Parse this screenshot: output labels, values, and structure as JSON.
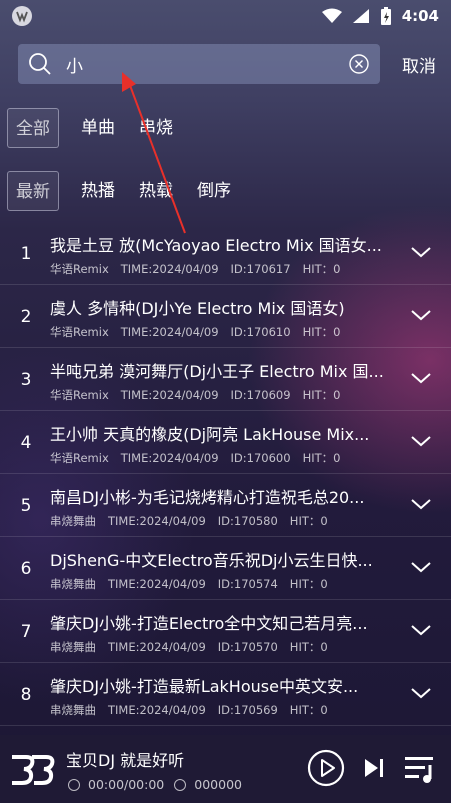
{
  "status_bar": {
    "time": "4:04"
  },
  "search": {
    "value": "小",
    "cancel_label": "取消"
  },
  "category_filters": [
    {
      "label": "全部",
      "active": true
    },
    {
      "label": "单曲",
      "active": false
    },
    {
      "label": "串烧",
      "active": false
    }
  ],
  "sort_filters": [
    {
      "label": "最新",
      "active": true
    },
    {
      "label": "热播",
      "active": false
    },
    {
      "label": "热载",
      "active": false
    },
    {
      "label": "倒序",
      "active": false
    }
  ],
  "songs": [
    {
      "index": "1",
      "title": "我是土豆 放(McYaoyao Electro Mix 国语女...",
      "genre": "华语Remix",
      "time": "TIME:2024/04/09",
      "id": "ID:170617",
      "hit": "HIT：0"
    },
    {
      "index": "2",
      "title": "虞人 多情种(DJ小Ye Electro Mix 国语女)",
      "genre": "华语Remix",
      "time": "TIME:2024/04/09",
      "id": "ID:170610",
      "hit": "HIT：0"
    },
    {
      "index": "3",
      "title": "半吨兄弟 漠河舞厅(Dj小王子 Electro Mix 国...",
      "genre": "华语Remix",
      "time": "TIME:2024/04/09",
      "id": "ID:170609",
      "hit": "HIT：0"
    },
    {
      "index": "4",
      "title": "王小帅 天真的橡皮(Dj阿亮 LakHouse Mix...",
      "genre": "华语Remix",
      "time": "TIME:2024/04/09",
      "id": "ID:170600",
      "hit": "HIT：0"
    },
    {
      "index": "5",
      "title": "南昌DJ小彬-为毛记烧烤精心打造祝毛总20...",
      "genre": "串烧舞曲",
      "time": "TIME:2024/04/09",
      "id": "ID:170580",
      "hit": "HIT：0"
    },
    {
      "index": "6",
      "title": "DjShenG-中文Electro音乐祝Dj小云生日快...",
      "genre": "串烧舞曲",
      "time": "TIME:2024/04/09",
      "id": "ID:170574",
      "hit": "HIT：0"
    },
    {
      "index": "7",
      "title": "肇庆DJ小姚-打造Electro全中文知己若月亮...",
      "genre": "串烧舞曲",
      "time": "TIME:2024/04/09",
      "id": "ID:170570",
      "hit": "HIT：0"
    },
    {
      "index": "8",
      "title": "肇庆DJ小姚-打造最新LakHouse中英文安...",
      "genre": "串烧舞曲",
      "time": "TIME:2024/04/09",
      "id": "ID:170569",
      "hit": "HIT：0"
    }
  ],
  "player": {
    "title": "宝贝DJ 就是好听",
    "time": "00:00/00:00",
    "count": "000000"
  },
  "icons": {
    "search": "search-icon",
    "clear": "clear-icon",
    "expand": "chevron-down-icon",
    "play": "play-icon",
    "next": "next-icon",
    "queue": "playlist-icon"
  },
  "colors": {
    "annotation_arrow": "#e8302a"
  }
}
